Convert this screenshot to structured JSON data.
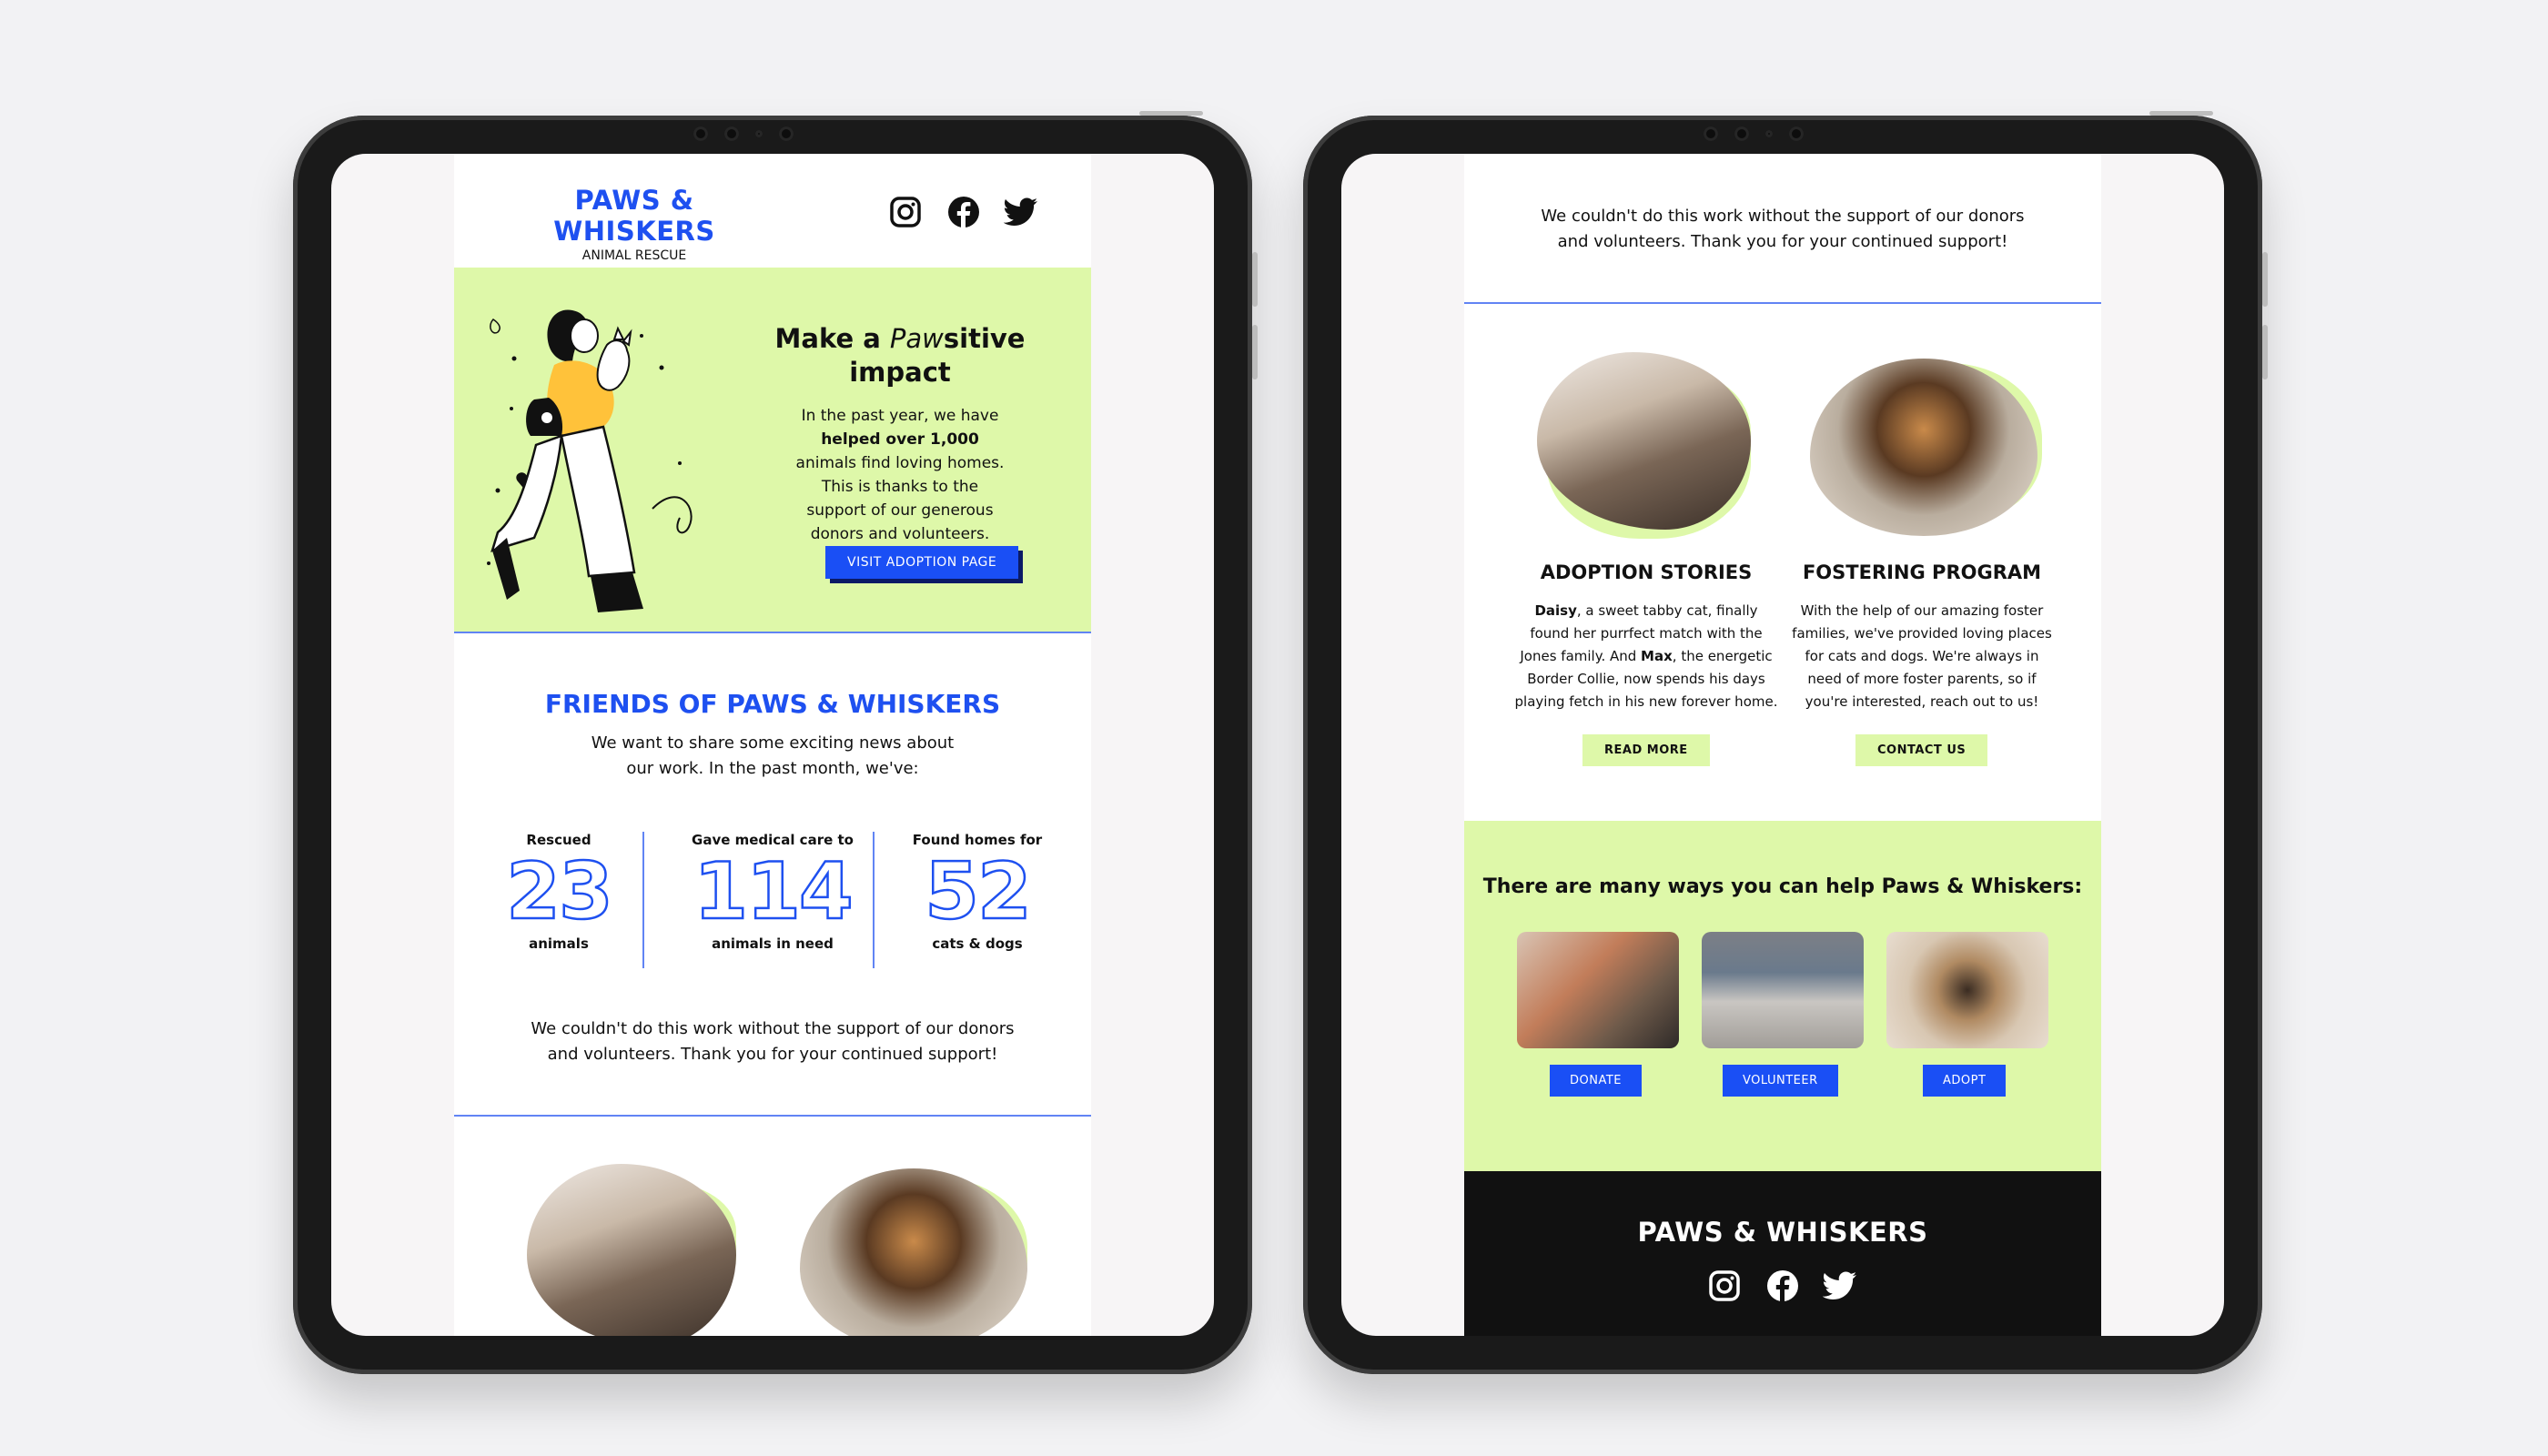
{
  "brand": {
    "name": "PAWS & WHISKERS",
    "tagline": "ANIMAL RESCUE"
  },
  "social_icons": [
    "instagram-icon",
    "facebook-icon",
    "twitter-icon"
  ],
  "hero": {
    "title_pre": "Make a ",
    "title_italic": "Paw",
    "title_post": "sitive",
    "title_line2": "impact",
    "body_1": "In the past year, we have ",
    "body_bold": "helped over 1,000",
    "body_2": " animals find loving homes. This is thanks to the support of our generous donors and volunteers.",
    "button": "VISIT ADOPTION PAGE"
  },
  "friends": {
    "title": "FRIENDS OF PAWS & WHISKERS",
    "intro": "We want to share some exciting news about our work. In the past month, we've:",
    "stats": [
      {
        "label": "Rescued",
        "value": "23",
        "unit": "animals"
      },
      {
        "label": "Gave medical care to",
        "value": "114",
        "unit": "animals in need"
      },
      {
        "label": "Found homes for",
        "value": "52",
        "unit": "cats & dogs"
      }
    ],
    "thanks": "We couldn't do this work without the support of our donors and volunteers. Thank you for your continued support!"
  },
  "programs": [
    {
      "title": "ADOPTION STORIES",
      "b1": "Daisy",
      "t1": ", a sweet tabby cat, finally found her purrfect match with the Jones family. And ",
      "b2": "Max",
      "t2": ", the energetic Border Collie, now spends his days playing fetch in his new forever home.",
      "button": "READ MORE"
    },
    {
      "title": "FOSTERING PROGRAM",
      "text": "With the help of our amazing foster families, we've provided loving places for cats and dogs. We're always in need of more foster parents, so if you're interested, reach out to us!",
      "button": "CONTACT US"
    }
  ],
  "help": {
    "title": "There are many ways you can help Paws & Whiskers:",
    "actions": [
      "DONATE",
      "VOLUNTEER",
      "ADOPT"
    ]
  },
  "footer": {
    "brand": "PAWS & WHISKERS"
  },
  "colors": {
    "accent": "#1e50f0",
    "lime": "#def8a9",
    "dark": "#111111"
  }
}
